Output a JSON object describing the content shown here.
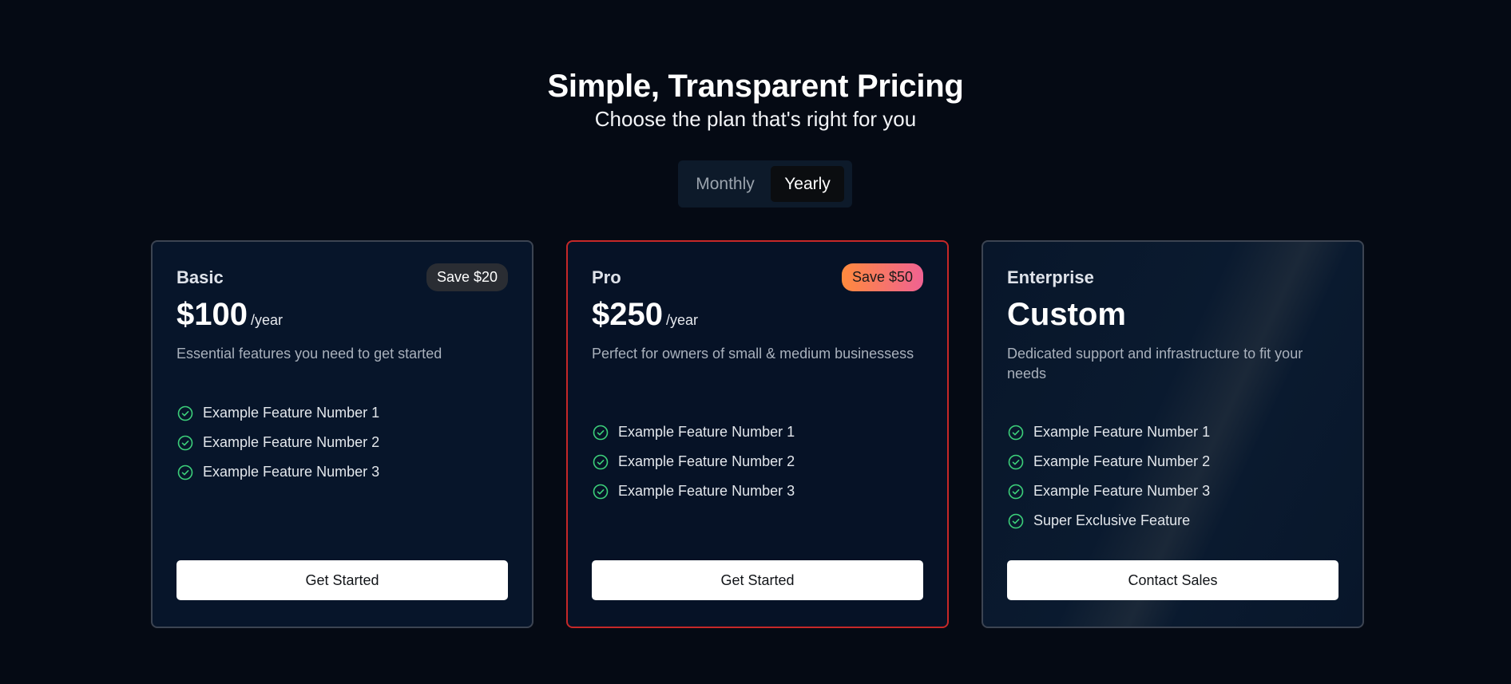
{
  "header": {
    "title": "Simple, Transparent Pricing",
    "subtitle": "Choose the plan that's right for you"
  },
  "billing_toggle": {
    "options": [
      "Monthly",
      "Yearly"
    ],
    "selected": "Yearly"
  },
  "colors": {
    "background": "#050a14",
    "card_border": "#3c4452",
    "highlight_border": "#c62828",
    "check": "#3ccf7a",
    "cta_background": "#ffffff"
  },
  "plans": [
    {
      "name": "Basic",
      "badge": "Save $20",
      "price": "$100",
      "period": "/year",
      "description": "Essential features you need to get started",
      "features": [
        "Example Feature Number 1",
        "Example Feature Number 2",
        "Example Feature Number 3"
      ],
      "cta": "Get Started"
    },
    {
      "name": "Pro",
      "badge": "Save $50",
      "price": "$250",
      "period": "/year",
      "description": "Perfect for owners of small & medium businessess",
      "features": [
        "Example Feature Number 1",
        "Example Feature Number 2",
        "Example Feature Number 3"
      ],
      "cta": "Get Started"
    },
    {
      "name": "Enterprise",
      "price": "Custom",
      "description": "Dedicated support and infrastructure to fit your needs",
      "features": [
        "Example Feature Number 1",
        "Example Feature Number 2",
        "Example Feature Number 3",
        "Super Exclusive Feature"
      ],
      "cta": "Contact Sales"
    }
  ]
}
